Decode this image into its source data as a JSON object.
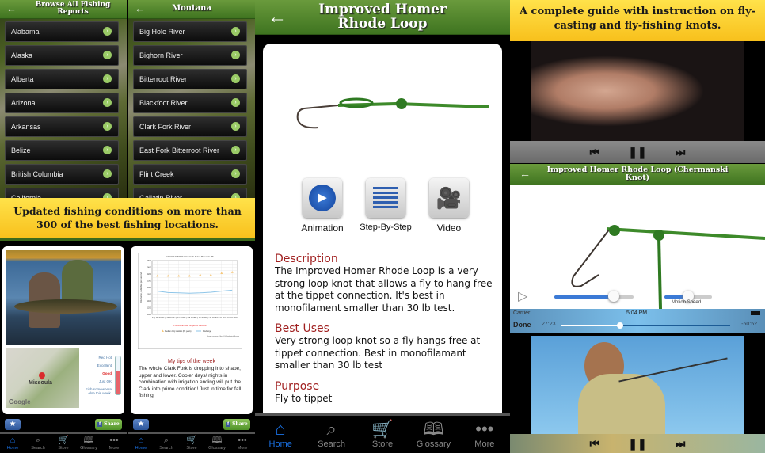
{
  "panel1": {
    "title": "Browse All Fishing Reports",
    "items": [
      "Alabama",
      "Alaska",
      "Alberta",
      "Arizona",
      "Arkansas",
      "Belize",
      "British Columbia",
      "California"
    ]
  },
  "panel2": {
    "title": "Montana",
    "items": [
      "Big Hole River",
      "Bighorn River",
      "Bitterroot River",
      "Blackfoot River",
      "Clark Fork River",
      "East Fork Bitterroot River",
      "Flint Creek",
      "Gallatin River"
    ]
  },
  "banner_left": "Updated fishing conditions on more than 300 of the best fishing locations.",
  "banner_right": "A complete guide with instruction on fly-casting and fly-fishing knots.",
  "report": {
    "map_label": "Missoula",
    "map_brand": "Google",
    "gauge": {
      "levels": [
        "Red Hot",
        "Excellent",
        "Good",
        "Just OK",
        "Fish somewhere else this week."
      ],
      "current": "Good",
      "fill_fraction": 0.62
    },
    "share_label": "Share"
  },
  "tips": {
    "heading": "My tips of the week",
    "body": "The whole Clark Fork is dropping into shape, upper and lower.  Cooler days/ nights in combination with irrigation ending will put the Clark into prime condition!  Just in time for fall fishing.",
    "share_label": "Share"
  },
  "chart_data": {
    "type": "line",
    "title": "USGS 12353000 Clark Fork below Missoula MT",
    "ylabel": "Discharge, cubic feet per second",
    "categories": [
      "Sep 25 2015",
      "Sep 26 2015",
      "Sep 27 2015",
      "Sep 28 2015",
      "Sep 29 2015",
      "Sep 30 2015",
      "Oct 01 2015",
      "Oct 02 2015"
    ],
    "series": [
      {
        "name": "Median daily statistic (85 years)",
        "type": "scatter",
        "color": "#f5c77a",
        "values": [
          2150,
          2150,
          2150,
          2150,
          2180,
          2180,
          2230,
          2260
        ]
      },
      {
        "name": "Discharge",
        "type": "line",
        "color": "#8ec5e8",
        "values": [
          1690,
          1650,
          1640,
          1630,
          1640,
          1660,
          1690,
          1720
        ]
      }
    ],
    "ylim": [
      1000,
      2600
    ],
    "annotation": "Provisional Data Subject to Revision",
    "credit": "Graph courtesy of the U.S. Geological Survey",
    "grid": true,
    "legend": "bottom"
  },
  "knot": {
    "title": "Improved Homer Rhode Loop",
    "buttons": [
      "Animation",
      "Step-By-Step",
      "Video"
    ],
    "sections": [
      {
        "heading": "Description",
        "body": "The Improved Homer Rhode Loop is a very strong loop knot that allows a fly to hang free at the tippet connection. It's best in monofilament smaller than 30 lb test."
      },
      {
        "heading": "Best Uses",
        "body": "Very strong loop knot so a fly hangs free at tippet connection.  Best in monofilamant smaller than 30 lb test"
      },
      {
        "heading": "Purpose",
        "body": "Fly to tippet"
      }
    ]
  },
  "tabs": [
    "Home",
    "Search",
    "Store",
    "Glossary",
    "More"
  ],
  "active_tab": "Home",
  "animation": {
    "title": "Improved Homer Rhode Loop (Chermanski Knot)",
    "progress": 0.75,
    "speed": 0.5,
    "speed_label": "Motion Speed"
  },
  "player": {
    "carrier": "Carrier",
    "time": "5:04 PM",
    "done": "Done",
    "elapsed": "27:23",
    "remaining": "-50:52",
    "progress": 0.35
  },
  "colors": {
    "accent_green": "#4f8a2a",
    "banner_yellow": "#fbd02c",
    "tab_active": "#1a73e8",
    "heading_red": "#a02020"
  }
}
